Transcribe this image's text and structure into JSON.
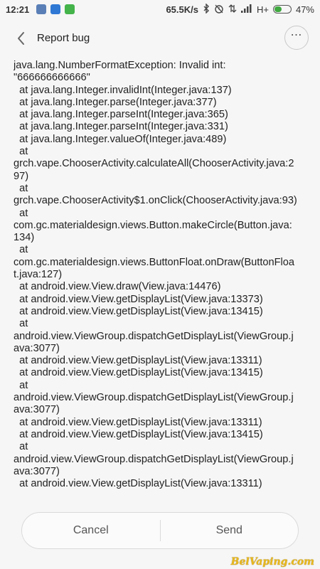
{
  "status_bar": {
    "time": "12:21",
    "net_speed": "65.5K/s",
    "network": "H+",
    "battery": "47%",
    "battery_level": 0.47,
    "app_icons": [
      {
        "name": "app-w-icon",
        "color": "#5a7fb6"
      },
      {
        "name": "app-blue-icon",
        "color": "#2f78d4"
      },
      {
        "name": "app-green-icon",
        "color": "#44b34a"
      }
    ],
    "colors": {
      "battery_fill": "#3fa83f"
    }
  },
  "header": {
    "title": "Report bug",
    "more_icon": "⋯"
  },
  "trace": [
    "java.lang.NumberFormatException: Invalid int:",
    "\"666666666666\"",
    "  at java.lang.Integer.invalidInt(Integer.java:137)",
    "  at java.lang.Integer.parse(Integer.java:377)",
    "  at java.lang.Integer.parseInt(Integer.java:365)",
    "  at java.lang.Integer.parseInt(Integer.java:331)",
    "  at java.lang.Integer.valueOf(Integer.java:489)",
    "  at",
    "grch.vape.ChooserActivity.calculateAll(ChooserActivity.java:2",
    "97)",
    "  at",
    "grch.vape.ChooserActivity$1.onClick(ChooserActivity.java:93)",
    "  at",
    "com.gc.materialdesign.views.Button.makeCircle(Button.java:",
    "134)",
    "  at",
    "com.gc.materialdesign.views.ButtonFloat.onDraw(ButtonFloa",
    "t.java:127)",
    "  at android.view.View.draw(View.java:14476)",
    "  at android.view.View.getDisplayList(View.java:13373)",
    "  at android.view.View.getDisplayList(View.java:13415)",
    "  at",
    "android.view.ViewGroup.dispatchGetDisplayList(ViewGroup.j",
    "ava:3077)",
    "  at android.view.View.getDisplayList(View.java:13311)",
    "  at android.view.View.getDisplayList(View.java:13415)",
    "  at",
    "android.view.ViewGroup.dispatchGetDisplayList(ViewGroup.j",
    "ava:3077)",
    "  at android.view.View.getDisplayList(View.java:13311)",
    "  at android.view.View.getDisplayList(View.java:13415)",
    "  at",
    "android.view.ViewGroup.dispatchGetDisplayList(ViewGroup.j",
    "ava:3077)",
    "  at android.view.View.getDisplayList(View.java:13311)"
  ],
  "actions": {
    "cancel": "Cancel",
    "send": "Send"
  },
  "watermark": "BelVaping.com"
}
